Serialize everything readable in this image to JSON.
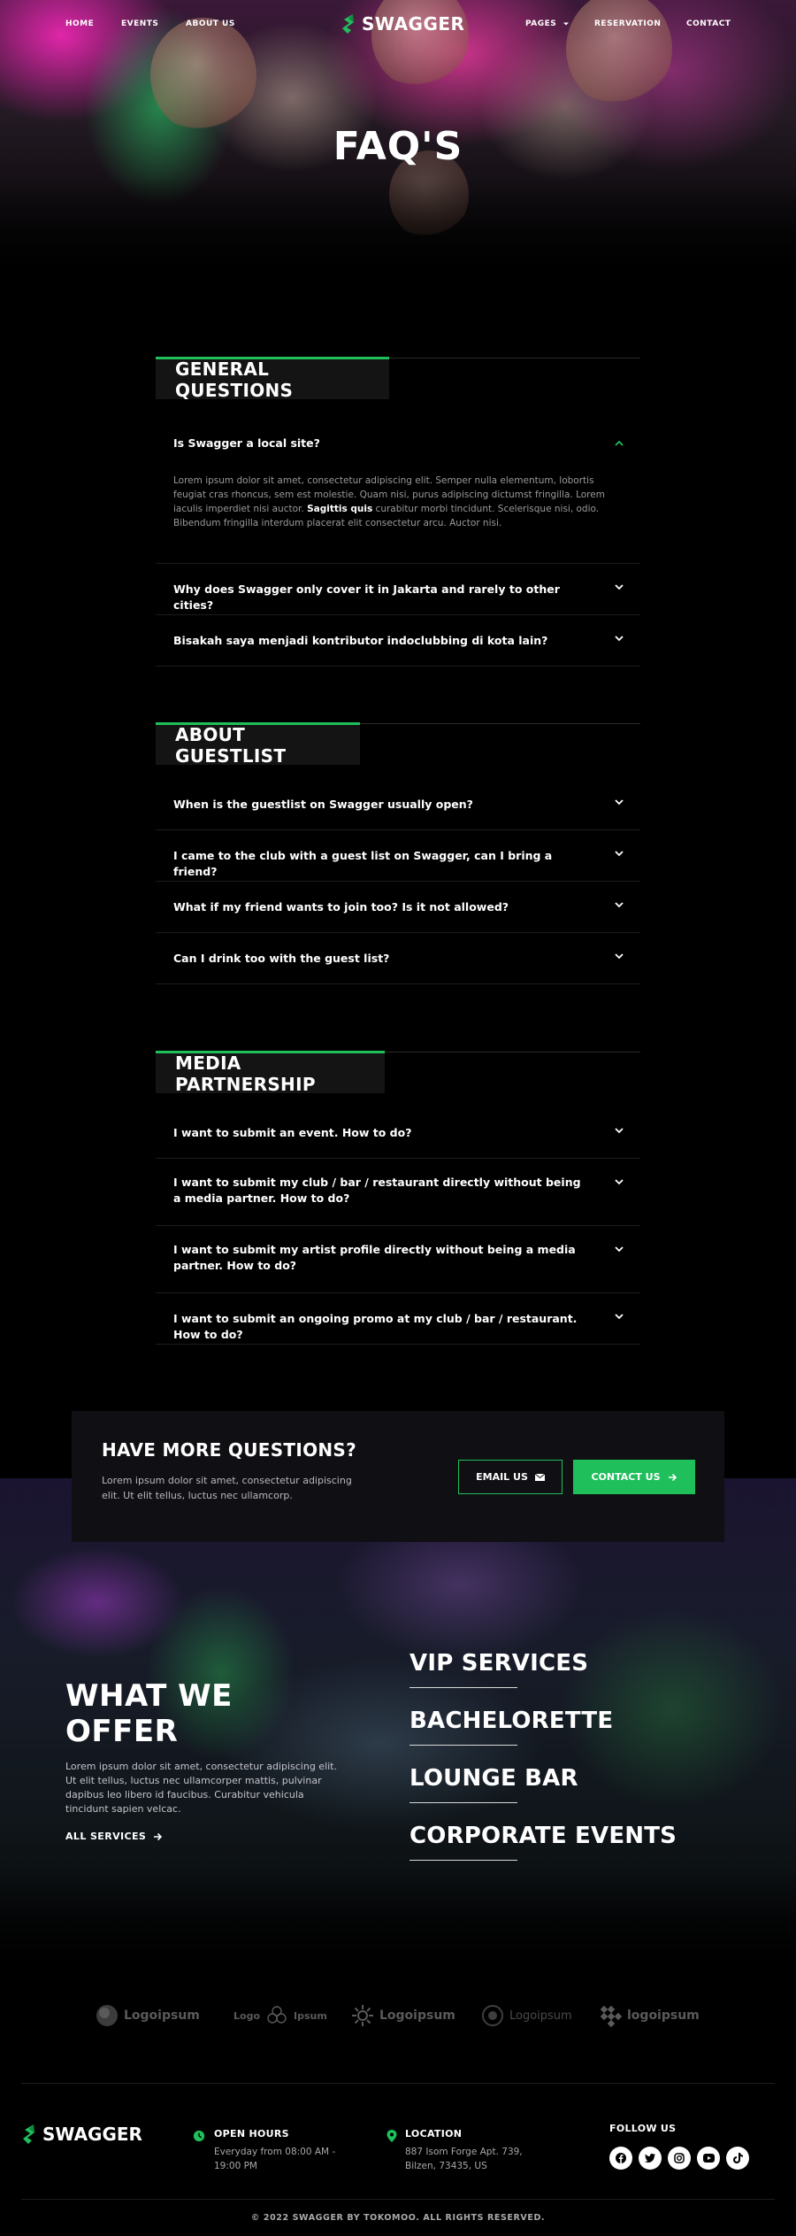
{
  "brand": {
    "name": "SWAGGER",
    "accent": "#1fbf5c"
  },
  "nav": {
    "home": "HOME",
    "events": "EVENTS",
    "about": "ABOUT US",
    "pages": "PAGES",
    "reservation": "RESERVATION",
    "contact": "CONTACT"
  },
  "hero": {
    "title": "FAQ'S"
  },
  "faq": [
    {
      "title": "GENERAL QUESTIONS",
      "items": [
        {
          "q": "Is Swagger a local site?",
          "expanded": true,
          "answer_before": "Lorem ipsum dolor sit amet, consectetur adipiscing elit. Semper nulla elementum, lobortis feugiat cras rhoncus, sem est molestie. Quam nisi, purus adipiscing dictumst fringilla. Lorem iaculis imperdiet nisi auctor. ",
          "answer_bold": "Sagittis quis",
          "answer_after": " curabitur morbi tincidunt. Scelerisque nisi, odio. Bibendum fringilla interdum placerat elit consectetur arcu. Auctor nisi."
        },
        {
          "q": "Why does Swagger only cover it in Jakarta and rarely to other cities?"
        },
        {
          "q": "Bisakah saya menjadi kontributor indoclubbing di kota lain?"
        }
      ]
    },
    {
      "title": "ABOUT GUESTLIST",
      "items": [
        {
          "q": "When is the guestlist on Swagger usually open?"
        },
        {
          "q": "I came to the club with a guest list on Swagger, can I bring a friend?"
        },
        {
          "q": "What if my friend wants to join too? Is it not allowed?"
        },
        {
          "q": "Can I drink too with the guest list?"
        }
      ]
    },
    {
      "title": "MEDIA PARTNERSHIP",
      "items": [
        {
          "q": "I want to submit an event. How to do?"
        },
        {
          "q": "I want to submit my club / bar / restaurant directly without being a media partner. How to do?"
        },
        {
          "q": "I want to submit my artist profile directly without being a media partner. How to do?"
        },
        {
          "q": "I want to submit an ongoing promo at my club / bar / restaurant. How to do?"
        }
      ]
    }
  ],
  "cta": {
    "title": "HAVE MORE QUESTIONS?",
    "text": "Lorem ipsum dolor sit amet, consectetur adipiscing elit. Ut elit tellus, luctus nec ullamcorp.",
    "email_label": "EMAIL US",
    "contact_label": "CONTACT US"
  },
  "offer": {
    "title_line1": "WHAT WE",
    "title_line2": "OFFER",
    "text": "Lorem ipsum dolor sit amet, consectetur adipiscing elit. Ut elit tellus, luctus nec ullamcorper mattis, pulvinar dapibus leo libero id faucibus. Curabitur vehicula tincidunt sapien velcac.",
    "link": "ALL SERVICES",
    "services": [
      "VIP SERVICES",
      "BACHELORETTE",
      "LOUNGE BAR",
      "CORPORATE EVENTS"
    ]
  },
  "partners": [
    "Logoipsum",
    "Logo",
    "Ipsum",
    "Logoipsum",
    "Logoipsum",
    "logoipsum"
  ],
  "footer": {
    "hours_title": "OPEN HOURS",
    "hours_text": "Everyday from 08:00 AM - 19:00 PM",
    "location_title": "LOCATION",
    "location_text": "887 Isom Forge Apt. 739, Bilzen, 73435, US",
    "follow": "FOLLOW US",
    "socials": [
      "facebook-icon",
      "twitter-icon",
      "instagram-icon",
      "youtube-icon",
      "tiktok-icon"
    ],
    "copyright": "© 2022 SWAGGER BY TOKOMOO. ALL RIGHTS RESERVED."
  }
}
